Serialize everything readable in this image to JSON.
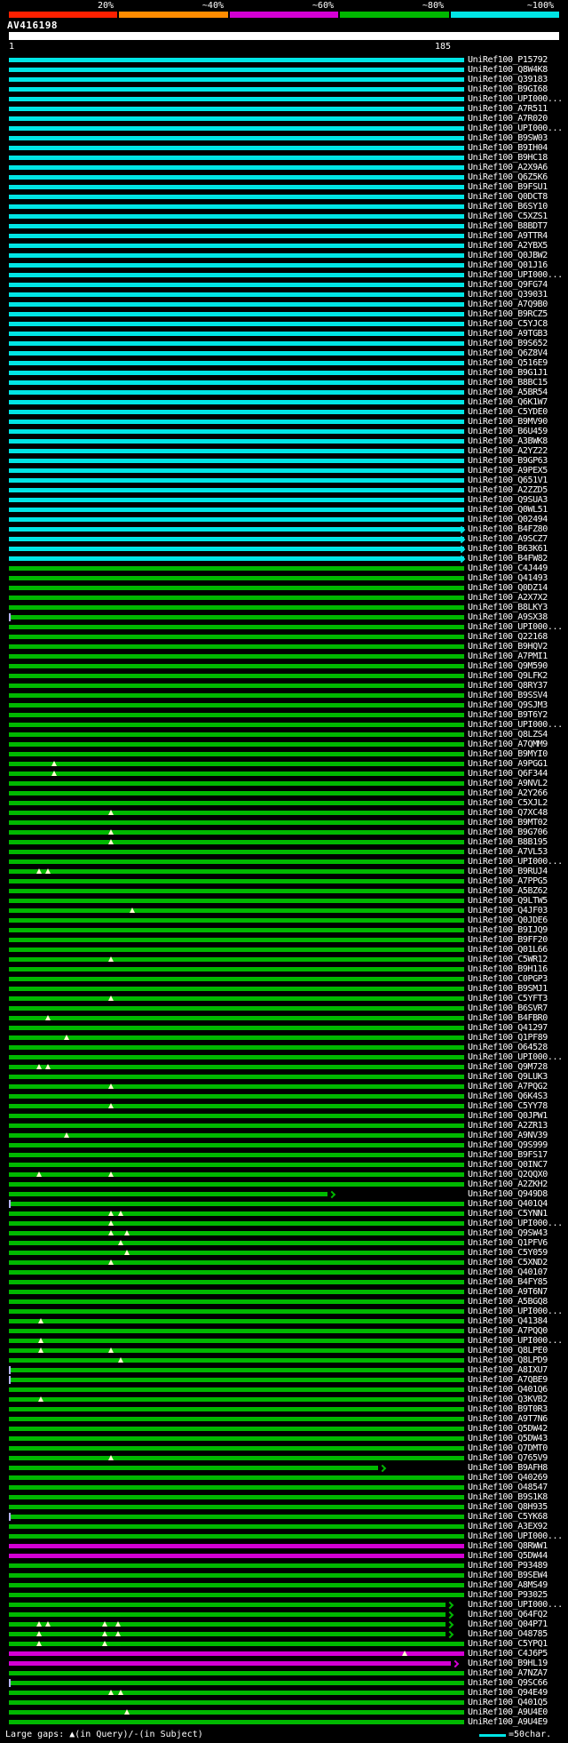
{
  "key": {
    "labels": [
      "20%",
      "~40%",
      "~60%",
      "~80%",
      "~100%"
    ],
    "segment_colors": [
      "#ff2000",
      "#ff8c00",
      "#d400d4",
      "#00b800",
      "#00e5e5"
    ]
  },
  "query": {
    "name": "AV416198",
    "start_label": "1",
    "end_label": "185"
  },
  "legend": {
    "gaps_text": "Large gaps: ▲(in Query)/-(in Subject)",
    "scale_text": "=50char.",
    "scale_color": "#00e5e5"
  },
  "palette": {
    "~100%": "#00e5e5",
    "~80%": "#00b800",
    "~60%": "#d400d4"
  },
  "chart_data": {
    "type": "bar",
    "title": "BLAST hit overview for query AV416198 (UniRef100 hits, colored by % identity)",
    "x_axis": {
      "start": 1,
      "end": 185
    },
    "rows": [
      {
        "label": "UniRef100_P15792",
        "identity": "~100%"
      },
      {
        "label": "UniRef100_Q8W4K8",
        "identity": "~100%"
      },
      {
        "label": "UniRef100_Q39183",
        "identity": "~100%"
      },
      {
        "label": "UniRef100_B9GI68",
        "identity": "~100%"
      },
      {
        "label": "UniRef100_UPI000...",
        "identity": "~100%"
      },
      {
        "label": "UniRef100_A7R511",
        "identity": "~100%"
      },
      {
        "label": "UniRef100_A7R020",
        "identity": "~100%"
      },
      {
        "label": "UniRef100_UPI000...",
        "identity": "~100%"
      },
      {
        "label": "UniRef100_B9SW03",
        "identity": "~100%"
      },
      {
        "label": "UniRef100_B9IH04",
        "identity": "~100%"
      },
      {
        "label": "UniRef100_B9HC18",
        "identity": "~100%"
      },
      {
        "label": "UniRef100_A2X9A6",
        "identity": "~100%"
      },
      {
        "label": "UniRef100_Q6Z5K6",
        "identity": "~100%"
      },
      {
        "label": "UniRef100_B9FSU1",
        "identity": "~100%"
      },
      {
        "label": "UniRef100_Q0DCT8",
        "identity": "~100%"
      },
      {
        "label": "UniRef100_B6SY10",
        "identity": "~100%"
      },
      {
        "label": "UniRef100_C5XZS1",
        "identity": "~100%"
      },
      {
        "label": "UniRef100_B8BDT7",
        "identity": "~100%"
      },
      {
        "label": "UniRef100_A9TTR4",
        "identity": "~100%"
      },
      {
        "label": "UniRef100_A2YBX5",
        "identity": "~100%"
      },
      {
        "label": "UniRef100_Q0JBW2",
        "identity": "~100%"
      },
      {
        "label": "UniRef100_Q01J16",
        "identity": "~100%"
      },
      {
        "label": "UniRef100_UPI000...",
        "identity": "~100%"
      },
      {
        "label": "UniRef100_Q9FG74",
        "identity": "~100%"
      },
      {
        "label": "UniRef100_Q39031",
        "identity": "~100%"
      },
      {
        "label": "UniRef100_A7Q9B0",
        "identity": "~100%"
      },
      {
        "label": "UniRef100_B9RCZ5",
        "identity": "~100%"
      },
      {
        "label": "UniRef100_C5YJC8",
        "identity": "~100%"
      },
      {
        "label": "UniRef100_A9TGB3",
        "identity": "~100%"
      },
      {
        "label": "UniRef100_B9S652",
        "identity": "~100%"
      },
      {
        "label": "UniRef100_Q6Z8V4",
        "identity": "~100%"
      },
      {
        "label": "UniRef100_Q516E9",
        "identity": "~100%"
      },
      {
        "label": "UniRef100_B9G1J1",
        "identity": "~100%"
      },
      {
        "label": "UniRef100_B8BC15",
        "identity": "~100%"
      },
      {
        "label": "UniRef100_A5BR54",
        "identity": "~100%"
      },
      {
        "label": "UniRef100_Q6K1W7",
        "identity": "~100%"
      },
      {
        "label": "UniRef100_C5YDE0",
        "identity": "~100%"
      },
      {
        "label": "UniRef100_B9MV90",
        "identity": "~100%"
      },
      {
        "label": "UniRef100_B6U459",
        "identity": "~100%"
      },
      {
        "label": "UniRef100_A3BWK8",
        "identity": "~100%"
      },
      {
        "label": "UniRef100_A2YZ22",
        "identity": "~100%"
      },
      {
        "label": "UniRef100_B9GP63",
        "identity": "~100%"
      },
      {
        "label": "UniRef100_A9PEX5",
        "identity": "~100%"
      },
      {
        "label": "UniRef100_Q651V1",
        "identity": "~100%"
      },
      {
        "label": "UniRef100_A2ZZD5",
        "identity": "~100%"
      },
      {
        "label": "UniRef100_Q9SUA3",
        "identity": "~100%"
      },
      {
        "label": "UniRef100_Q0WL51",
        "identity": "~100%"
      },
      {
        "label": "UniRef100_Q02494",
        "identity": "~100%"
      },
      {
        "label": "UniRef100_B4FZ80",
        "identity": "~100%",
        "arrow": true
      },
      {
        "label": "UniRef100_A9SCZ7",
        "identity": "~100%",
        "arrow": true
      },
      {
        "label": "UniRef100_B63K61",
        "identity": "~100%",
        "arrow": true
      },
      {
        "label": "UniRef100_B4FW82",
        "identity": "~100%",
        "arrow": true
      },
      {
        "label": "UniRef100_C4J449",
        "identity": "~80%"
      },
      {
        "label": "UniRef100_Q41493",
        "identity": "~80%"
      },
      {
        "label": "UniRef100_Q0DZ14",
        "identity": "~80%"
      },
      {
        "label": "UniRef100_A2X7X2",
        "identity": "~80%"
      },
      {
        "label": "UniRef100_B8LKY3",
        "identity": "~80%"
      },
      {
        "label": "UniRef100_A9SX38",
        "identity": "~80%",
        "tick": true
      },
      {
        "label": "UniRef100_UPI000...",
        "identity": "~80%"
      },
      {
        "label": "UniRef100_Q22168",
        "identity": "~80%"
      },
      {
        "label": "UniRef100_B9HQV2",
        "identity": "~80%"
      },
      {
        "label": "UniRef100_A7PMI1",
        "identity": "~80%"
      },
      {
        "label": "UniRef100_Q9M590",
        "identity": "~80%"
      },
      {
        "label": "UniRef100_Q9LFK2",
        "identity": "~80%"
      },
      {
        "label": "UniRef100_Q8RY37",
        "identity": "~80%"
      },
      {
        "label": "UniRef100_B9SSV4",
        "identity": "~80%"
      },
      {
        "label": "UniRef100_Q9SJM3",
        "identity": "~80%"
      },
      {
        "label": "UniRef100_B9T6Y2",
        "identity": "~80%"
      },
      {
        "label": "UniRef100_UPI000...",
        "identity": "~80%"
      },
      {
        "label": "UniRef100_Q8LZS4",
        "identity": "~80%"
      },
      {
        "label": "UniRef100_A7QMM9",
        "identity": "~80%"
      },
      {
        "label": "UniRef100_B9MYI0",
        "identity": "~80%"
      },
      {
        "label": "UniRef100_A9PGG1",
        "identity": "~80%",
        "gaps": [
          0.1
        ]
      },
      {
        "label": "UniRef100_Q6F344",
        "identity": "~80%",
        "gaps": [
          0.1
        ]
      },
      {
        "label": "UniRef100_A9NVL2",
        "identity": "~80%"
      },
      {
        "label": "UniRef100_A2Y266",
        "identity": "~80%"
      },
      {
        "label": "UniRef100_C5XJL2",
        "identity": "~80%"
      },
      {
        "label": "UniRef100_Q7XC48",
        "identity": "~80%",
        "gaps": [
          0.225
        ]
      },
      {
        "label": "UniRef100_B9MT02",
        "identity": "~80%"
      },
      {
        "label": "UniRef100_B9G706",
        "identity": "~80%",
        "gaps": [
          0.225
        ]
      },
      {
        "label": "UniRef100_B8B195",
        "identity": "~80%",
        "gaps": [
          0.225
        ]
      },
      {
        "label": "UniRef100_A7VL53",
        "identity": "~80%"
      },
      {
        "label": "UniRef100_UPI000...",
        "identity": "~80%"
      },
      {
        "label": "UniRef100_B9RUJ4",
        "identity": "~80%",
        "gaps": [
          0.066,
          0.085
        ]
      },
      {
        "label": "UniRef100_A7PPG5",
        "identity": "~80%"
      },
      {
        "label": "UniRef100_A5BZ62",
        "identity": "~80%"
      },
      {
        "label": "UniRef100_Q9LTW5",
        "identity": "~80%"
      },
      {
        "label": "UniRef100_Q4JF03",
        "identity": "~80%",
        "gaps": [
          0.27
        ]
      },
      {
        "label": "UniRef100_Q0JDE6",
        "identity": "~80%"
      },
      {
        "label": "UniRef100_B9IJQ9",
        "identity": "~80%"
      },
      {
        "label": "UniRef100_B9FF20",
        "identity": "~80%"
      },
      {
        "label": "UniRef100_Q01L66",
        "identity": "~80%"
      },
      {
        "label": "UniRef100_C5WR12",
        "identity": "~80%",
        "gaps": [
          0.225
        ]
      },
      {
        "label": "UniRef100_B9H116",
        "identity": "~80%"
      },
      {
        "label": "UniRef100_C0PGP3",
        "identity": "~80%"
      },
      {
        "label": "UniRef100_B9SMJ1",
        "identity": "~80%"
      },
      {
        "label": "UniRef100_C5YFT3",
        "identity": "~80%",
        "gaps": [
          0.225
        ]
      },
      {
        "label": "UniRef100_B6SVR7",
        "identity": "~80%"
      },
      {
        "label": "UniRef100_B4FBR0",
        "identity": "~80%",
        "gaps": [
          0.085
        ]
      },
      {
        "label": "UniRef100_Q41297",
        "identity": "~80%"
      },
      {
        "label": "UniRef100_Q1PF89",
        "identity": "~80%",
        "gaps": [
          0.127
        ]
      },
      {
        "label": "UniRef100_O64528",
        "identity": "~80%"
      },
      {
        "label": "UniRef100_UPI000...",
        "identity": "~80%"
      },
      {
        "label": "UniRef100_Q9M728",
        "identity": "~80%",
        "gaps": [
          0.066,
          0.085
        ]
      },
      {
        "label": "UniRef100_Q9LUK3",
        "identity": "~80%"
      },
      {
        "label": "UniRef100_A7PQG2",
        "identity": "~80%",
        "gaps": [
          0.225
        ]
      },
      {
        "label": "UniRef100_Q6K4S3",
        "identity": "~80%"
      },
      {
        "label": "UniRef100_C5YY78",
        "identity": "~80%",
        "gaps": [
          0.225
        ]
      },
      {
        "label": "UniRef100_Q0JPW1",
        "identity": "~80%"
      },
      {
        "label": "UniRef100_A2ZR13",
        "identity": "~80%"
      },
      {
        "label": "UniRef100_A9NV39",
        "identity": "~80%",
        "gaps": [
          0.127
        ]
      },
      {
        "label": "UniRef100_Q9S999",
        "identity": "~80%"
      },
      {
        "label": "UniRef100_B9FS17",
        "identity": "~80%"
      },
      {
        "label": "UniRef100_Q0INC7",
        "identity": "~80%"
      },
      {
        "label": "UniRef100_Q2QQX0",
        "identity": "~80%",
        "gaps": [
          0.066,
          0.225
        ]
      },
      {
        "label": "UniRef100_A2ZKH2",
        "identity": "~80%"
      },
      {
        "label": "UniRef100_Q949D8",
        "identity": "~80%",
        "end": 0.7,
        "arrow": true
      },
      {
        "label": "UniRef100_Q401Q4",
        "identity": "~80%",
        "tick": true
      },
      {
        "label": "UniRef100_C5YNN1",
        "identity": "~80%",
        "gaps": [
          0.225,
          0.245
        ]
      },
      {
        "label": "UniRef100_UPI000...",
        "identity": "~80%",
        "gaps": [
          0.225
        ]
      },
      {
        "label": "UniRef100_Q9SW43",
        "identity": "~80%",
        "gaps": [
          0.225,
          0.26
        ]
      },
      {
        "label": "UniRef100_Q1PFV6",
        "identity": "~80%",
        "gaps": [
          0.245
        ]
      },
      {
        "label": "UniRef100_C5Y059",
        "identity": "~80%",
        "gaps": [
          0.26
        ]
      },
      {
        "label": "UniRef100_C5XND2",
        "identity": "~80%",
        "gaps": [
          0.225
        ]
      },
      {
        "label": "UniRef100_Q40107",
        "identity": "~80%"
      },
      {
        "label": "UniRef100_B4FY85",
        "identity": "~80%"
      },
      {
        "label": "UniRef100_A9T6N7",
        "identity": "~80%"
      },
      {
        "label": "UniRef100_A5BGQ8",
        "identity": "~80%"
      },
      {
        "label": "UniRef100_UPI000...",
        "identity": "~80%"
      },
      {
        "label": "UniRef100_Q41384",
        "identity": "~80%",
        "gaps": [
          0.07
        ]
      },
      {
        "label": "UniRef100_A7PQQ0",
        "identity": "~80%"
      },
      {
        "label": "UniRef100_UPI000...",
        "identity": "~80%",
        "gaps": [
          0.07
        ]
      },
      {
        "label": "UniRef100_Q8LPE0",
        "identity": "~80%",
        "gaps": [
          0.07,
          0.225
        ]
      },
      {
        "label": "UniRef100_Q8LPD9",
        "identity": "~80%",
        "gaps": [
          0.245
        ]
      },
      {
        "label": "UniRef100_A8IXU7",
        "identity": "~80%",
        "tick": true
      },
      {
        "label": "UniRef100_A7QBE9",
        "identity": "~80%",
        "tick": true
      },
      {
        "label": "UniRef100_Q401Q6",
        "identity": "~80%"
      },
      {
        "label": "UniRef100_Q3KVB2",
        "identity": "~80%",
        "gaps": [
          0.07
        ]
      },
      {
        "label": "UniRef100_B9T0R3",
        "identity": "~80%"
      },
      {
        "label": "UniRef100_A9T7N6",
        "identity": "~80%"
      },
      {
        "label": "UniRef100_Q5DW42",
        "identity": "~80%"
      },
      {
        "label": "UniRef100_Q5DW43",
        "identity": "~80%"
      },
      {
        "label": "UniRef100_Q7DMT0",
        "identity": "~80%"
      },
      {
        "label": "UniRef100_Q765V9",
        "identity": "~80%",
        "gaps": [
          0.225
        ]
      },
      {
        "label": "UniRef100_B9AFH8",
        "identity": "~80%",
        "end": 0.81,
        "arrow": true
      },
      {
        "label": "UniRef100_Q40269",
        "identity": "~80%"
      },
      {
        "label": "UniRef100_O48547",
        "identity": "~80%"
      },
      {
        "label": "UniRef100_B9S1K8",
        "identity": "~80%"
      },
      {
        "label": "UniRef100_Q8H935",
        "identity": "~80%"
      },
      {
        "label": "UniRef100_C5YK68",
        "identity": "~80%",
        "tick": true
      },
      {
        "label": "UniRef100_A3EX92",
        "identity": "~80%"
      },
      {
        "label": "UniRef100_UPI000...",
        "identity": "~80%"
      },
      {
        "label": "UniRef100_Q8RWW1",
        "identity": "~60%"
      },
      {
        "label": "UniRef100_Q5DW44",
        "identity": "~60%"
      },
      {
        "label": "UniRef100_P93489",
        "identity": "~80%"
      },
      {
        "label": "UniRef100_B9SEW4",
        "identity": "~80%"
      },
      {
        "label": "UniRef100_A8MS49",
        "identity": "~80%"
      },
      {
        "label": "UniRef100_P93025",
        "identity": "~80%"
      },
      {
        "label": "UniRef100_UPI000...",
        "identity": "~80%",
        "end": 0.96,
        "arrow": true
      },
      {
        "label": "UniRef100_Q64FQ2",
        "identity": "~80%",
        "end": 0.96,
        "arrow": true
      },
      {
        "label": "UniRef100_Q04P71",
        "identity": "~80%",
        "end": 0.96,
        "arrow": true,
        "gaps": [
          0.066,
          0.085,
          0.21,
          0.24
        ]
      },
      {
        "label": "UniRef100_O48785",
        "identity": "~80%",
        "end": 0.96,
        "arrow": true,
        "gaps": [
          0.066,
          0.21,
          0.24
        ]
      },
      {
        "label": "UniRef100_C5YPQ1",
        "identity": "~80%",
        "gaps": [
          0.066,
          0.21
        ]
      },
      {
        "label": "UniRef100_C4J6P5",
        "identity": "~60%",
        "gaps": [
          0.87
        ]
      },
      {
        "label": "UniRef100_B9HL19",
        "identity": "~60%",
        "end": 0.97,
        "arrow": true
      },
      {
        "label": "UniRef100_A7NZA7",
        "identity": "~80%"
      },
      {
        "label": "UniRef100_Q9SC66",
        "identity": "~80%",
        "tick": true
      },
      {
        "label": "UniRef100_Q94E49",
        "identity": "~80%",
        "gaps": [
          0.225,
          0.245
        ]
      },
      {
        "label": "UniRef100_Q401Q5",
        "identity": "~80%"
      },
      {
        "label": "UniRef100_A9U4E0",
        "identity": "~80%",
        "gaps": [
          0.26
        ]
      },
      {
        "label": "UniRef100_A9U4E9",
        "identity": "~80%"
      }
    ]
  }
}
